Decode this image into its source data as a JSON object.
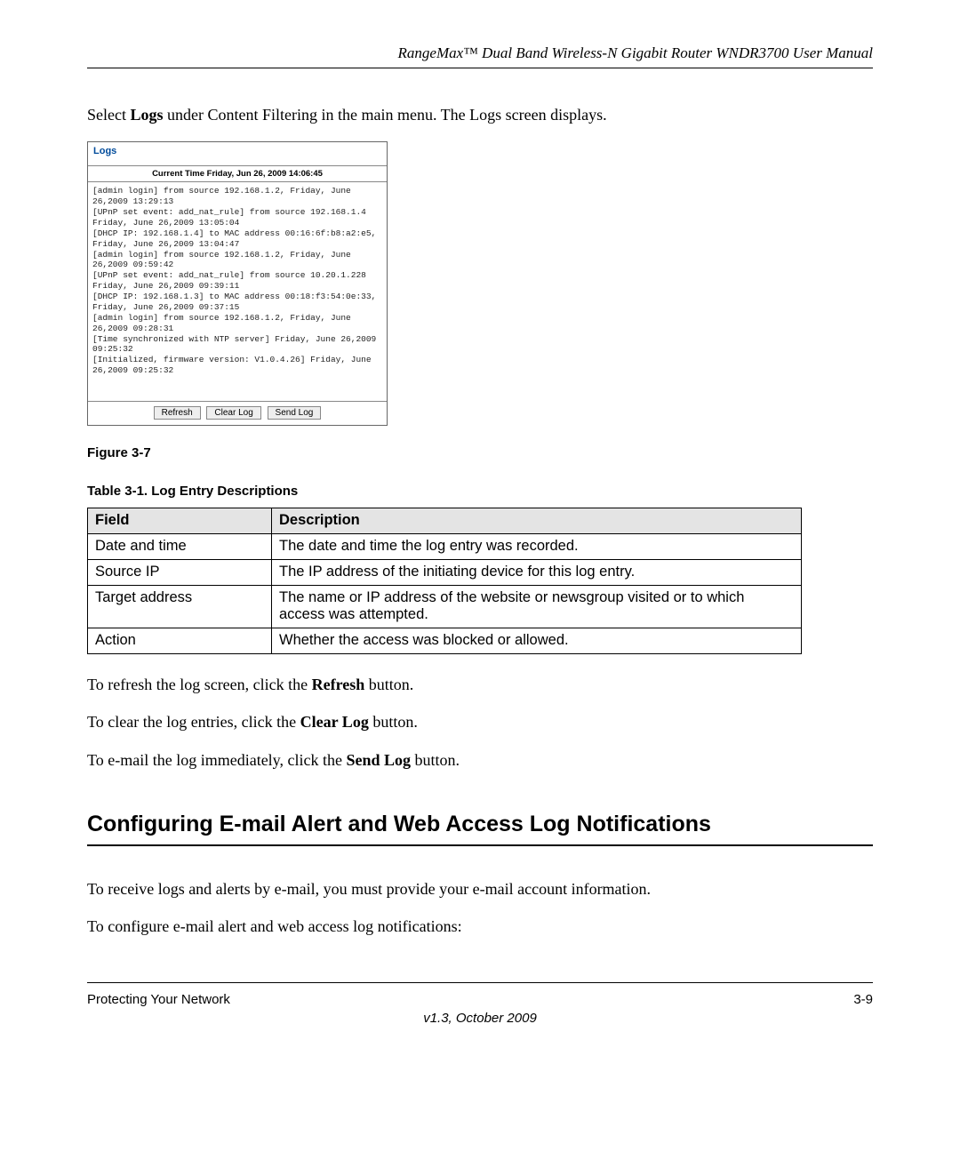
{
  "header": {
    "title": "RangeMax™ Dual Band Wireless-N Gigabit Router WNDR3700 User Manual"
  },
  "intro": {
    "before_logs": "Select ",
    "logs_word": "Logs",
    "after_logs": " under Content Filtering in the main menu. The Logs screen displays."
  },
  "logs_box": {
    "title": "Logs",
    "current_time": "Current Time Friday, Jun 26, 2009 14:06:45",
    "content": "[admin login] from source 192.168.1.2, Friday, June 26,2009 13:29:13\n[UPnP set event: add_nat_rule] from source 192.168.1.4 Friday, June 26,2009 13:05:04\n[DHCP IP: 192.168.1.4] to MAC address 00:16:6f:b8:a2:e5, Friday, June 26,2009 13:04:47\n[admin login] from source 192.168.1.2, Friday, June 26,2009 09:59:42\n[UPnP set event: add_nat_rule] from source 10.20.1.228 Friday, June 26,2009 09:39:11\n[DHCP IP: 192.168.1.3] to MAC address 00:18:f3:54:0e:33, Friday, June 26,2009 09:37:15\n[admin login] from source 192.168.1.2, Friday, June 26,2009 09:28:31\n[Time synchronized with NTP server] Friday, June 26,2009 09:25:32\n[Initialized, firmware version: V1.0.4.26] Friday, June 26,2009 09:25:32",
    "buttons": {
      "refresh": "Refresh",
      "clear_log": "Clear Log",
      "send_log": "Send Log"
    }
  },
  "figure_caption": "Figure 3-7",
  "table_caption": "Table 3-1.  Log Entry Descriptions",
  "table": {
    "headers": {
      "field": "Field",
      "description": "Description"
    },
    "rows": [
      {
        "field": "Date and time",
        "description": "The date and time the log entry was recorded."
      },
      {
        "field": "Source IP",
        "description": "The IP address of the initiating device for this log entry."
      },
      {
        "field": "Target address",
        "description": "The name or IP address of the website or newsgroup visited or to which access was attempted."
      },
      {
        "field": "Action",
        "description": "Whether the access was blocked or allowed."
      }
    ]
  },
  "instructions": {
    "refresh_before": "To refresh the log screen, click the ",
    "refresh_bold": "Refresh",
    "refresh_after": " button.",
    "clear_before": "To clear the log entries, click the ",
    "clear_bold": "Clear Log",
    "clear_after": " button.",
    "send_before": "To e-mail the log immediately, click the ",
    "send_bold": "Send Log",
    "send_after": " button."
  },
  "section_heading": "Configuring E-mail Alert and Web Access Log Notifications",
  "section_body": {
    "p1": "To receive logs and alerts by e-mail, you must provide your e-mail account information.",
    "p2": "To configure e-mail alert and web access log notifications:"
  },
  "footer": {
    "left": "Protecting Your Network",
    "right": "3-9",
    "version": "v1.3, October 2009"
  }
}
